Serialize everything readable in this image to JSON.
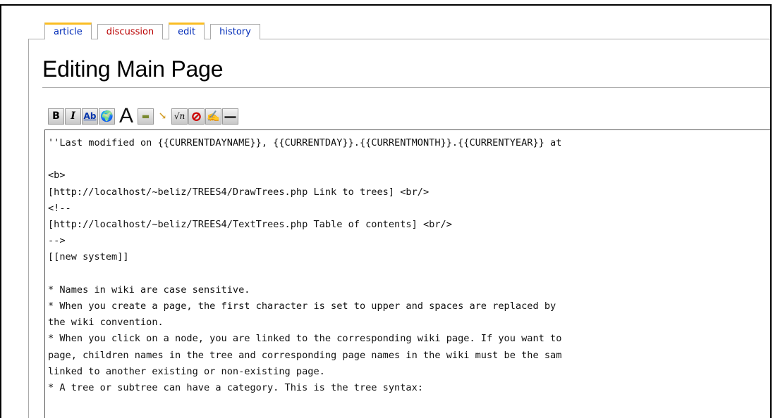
{
  "tabs": [
    {
      "label": "article"
    },
    {
      "label": "discussion"
    },
    {
      "label": "edit"
    },
    {
      "label": "history"
    }
  ],
  "page_title": "Editing Main Page",
  "toolbar": {
    "buttons": [
      {
        "icon": "bold-icon",
        "glyph": "B"
      },
      {
        "icon": "italic-icon",
        "glyph": "I"
      },
      {
        "icon": "internal-link-icon",
        "glyph": "Ab"
      },
      {
        "icon": "external-link-icon",
        "glyph": "🌍"
      },
      {
        "icon": "headline-icon",
        "glyph": "A"
      },
      {
        "icon": "image-icon",
        "glyph": "▬"
      },
      {
        "icon": "media-icon",
        "glyph": "↘"
      },
      {
        "icon": "math-icon",
        "glyph": "√n"
      },
      {
        "icon": "nowiki-icon",
        "glyph": "⊘"
      },
      {
        "icon": "signature-icon",
        "glyph": "✍"
      },
      {
        "icon": "horizontal-line-icon",
        "glyph": "—"
      }
    ]
  },
  "editor": {
    "lines": [
      "''Last modified on {{CURRENTDAYNAME}}, {{CURRENTDAY}}.{{CURRENTMONTH}}.{{CURRENTYEAR}} at",
      "",
      "<b>",
      "[http://localhost/~beliz/TREES4/DrawTrees.php Link to trees] <br/>",
      "<!--",
      "[http://localhost/~beliz/TREES4/TextTrees.php Table of contents] <br/>",
      "-->",
      "[[new system]]",
      "",
      "* Names in wiki are case sensitive.",
      "* When you create a page, the first character is set to upper and spaces are replaced by",
      "the wiki convention.",
      "* When you click on a node, you are linked to the corresponding wiki page. If you want to",
      "page, children names in the tree and corresponding page names in the wiki must be the sam",
      "linked to another existing or non-existing page.",
      "* A tree or subtree can have a category. This is the tree syntax:"
    ]
  }
}
